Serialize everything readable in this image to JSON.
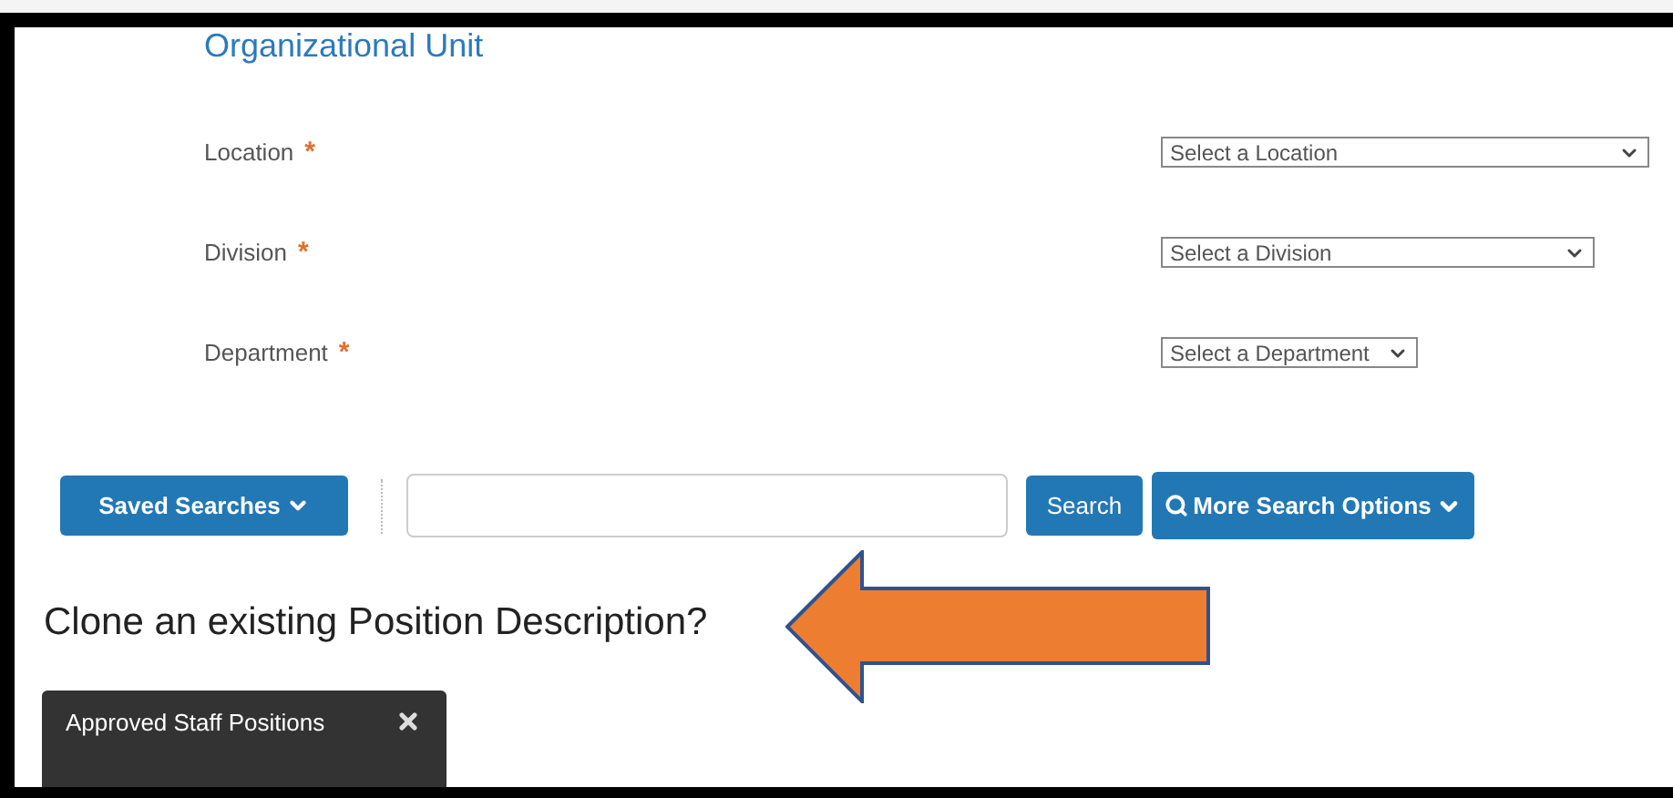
{
  "heading": "Organizational Unit",
  "fields": [
    {
      "label": "Location",
      "marker": "*",
      "placeholder": "Select a Location"
    },
    {
      "label": "Division",
      "marker": "*",
      "placeholder": "Select a Division"
    },
    {
      "label": "Department",
      "marker": "*",
      "placeholder": "Select a Department"
    }
  ],
  "toolbar": {
    "saved_searches": "Saved Searches",
    "search_button": "Search",
    "more_options": "More Search Options"
  },
  "clone_heading": "Clone an existing Position Description?",
  "panel": {
    "title": "Approved Staff Positions"
  }
}
